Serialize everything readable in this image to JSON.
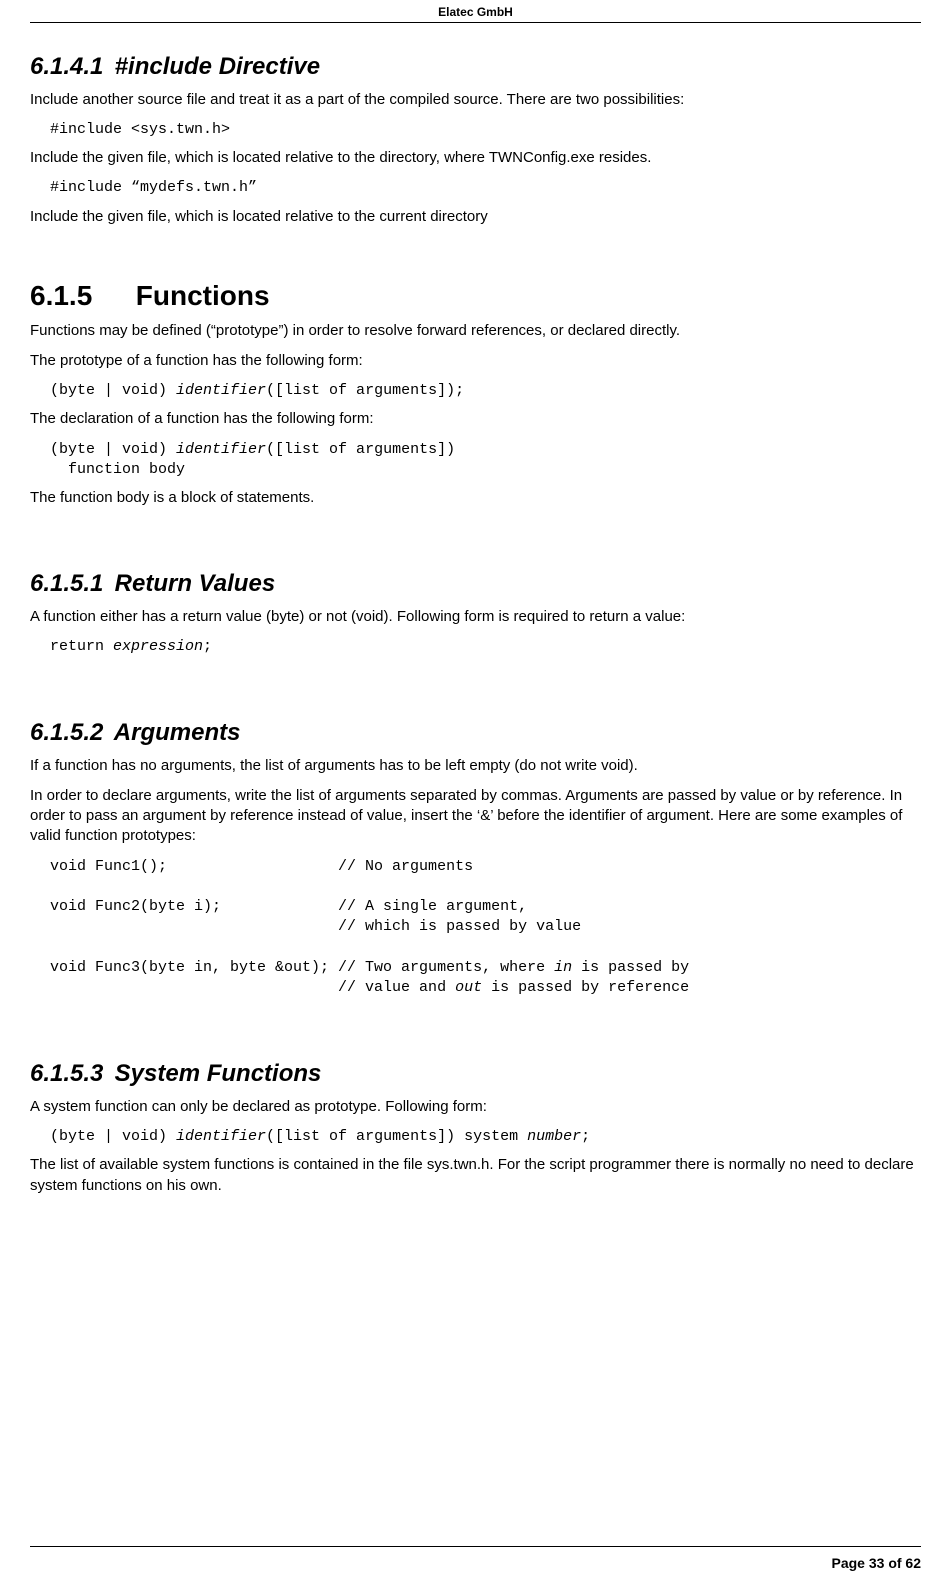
{
  "header": {
    "company": "Elatec GmbH"
  },
  "footer": {
    "page": "Page 33 of 62"
  },
  "sections": {
    "s61411": {
      "num": "6.1.4.1",
      "title": "#include Directive",
      "p1": "Include another source file and treat it as a part of the compiled source. There are two possibilities:",
      "code1": "#include <sys.twn.h>",
      "p2": "Include the given file, which is located relative to the directory, where TWNConfig.exe resides.",
      "code2": "#include “mydefs.twn.h”",
      "p3": "Include the given file, which is located relative to the current directory"
    },
    "s615": {
      "num": "6.1.5",
      "title": "Functions",
      "p1": "Functions may be defined (“prototype”) in order to resolve forward references, or declared directly.",
      "p2": "The prototype of a function has the following form:",
      "code1a": "(byte | void) ",
      "code1b": "identifier",
      "code1c": "([list of arguments]);",
      "p3": "The declaration of a function has the following form:",
      "code2a": "(byte | void) ",
      "code2b": "identifier",
      "code2c": "([list of arguments])",
      "code2d": "  function body",
      "p4": "The function body is a block of statements."
    },
    "s6151": {
      "num": "6.1.5.1",
      "title": "Return Values",
      "p1": "A function either has a return value (byte) or not (void). Following form is required to return a value:",
      "code1a": "return ",
      "code1b": "expression",
      "code1c": ";"
    },
    "s6152": {
      "num": "6.1.5.2",
      "title": "Arguments",
      "p1": "If a function has no arguments, the list of arguments has to be left empty (do not write void).",
      "p2": "In order to declare arguments, write the list of arguments separated by commas. Arguments are passed by value or by reference. In order to pass an argument by reference instead of value, insert the ‘&’ before the identifier of argument. Here are some examples of valid function prototypes:",
      "code_l1": "void Func1();                   // No arguments",
      "code_l2": "void Func2(byte i);             // A single argument,",
      "code_l3": "                                // which is passed by value",
      "code_l4a": "void Func3(byte in, byte &out); // Two arguments, where ",
      "code_l4b": "in",
      "code_l4c": " is passed by",
      "code_l5a": "                                // value and ",
      "code_l5b": "out",
      "code_l5c": " is passed by reference"
    },
    "s6153": {
      "num": "6.1.5.3",
      "title": "System Functions",
      "p1": "A system function can only be declared as prototype. Following form:",
      "code1a": "(byte | void) ",
      "code1b": "identifier",
      "code1c": "([list of arguments]) system ",
      "code1d": "number",
      "code1e": ";",
      "p2": "The list of available system functions is contained in the file sys.twn.h. For the script programmer there is normally no need to declare system functions on his own."
    }
  }
}
